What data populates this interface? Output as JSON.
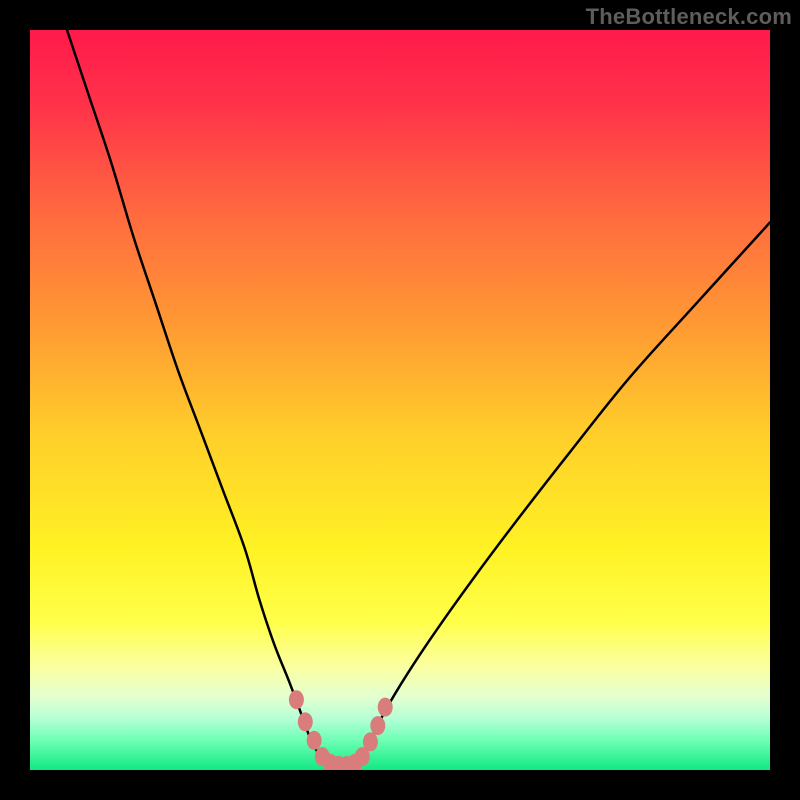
{
  "watermark": "TheBottleneck.com",
  "colors": {
    "frame": "#000000",
    "curve": "#000000",
    "marker_fill": "#d97c7c",
    "marker_stroke": "#a94b4b",
    "gradient_stops": [
      {
        "offset": 0.0,
        "color": "#ff1a4b"
      },
      {
        "offset": 0.1,
        "color": "#ff3249"
      },
      {
        "offset": 0.25,
        "color": "#ff6a3f"
      },
      {
        "offset": 0.4,
        "color": "#ff9a33"
      },
      {
        "offset": 0.55,
        "color": "#ffcf2a"
      },
      {
        "offset": 0.7,
        "color": "#fff224"
      },
      {
        "offset": 0.8,
        "color": "#ffff4a"
      },
      {
        "offset": 0.86,
        "color": "#fbffa0"
      },
      {
        "offset": 0.9,
        "color": "#e4ffcf"
      },
      {
        "offset": 0.93,
        "color": "#b6ffd7"
      },
      {
        "offset": 0.96,
        "color": "#6dffb4"
      },
      {
        "offset": 1.0,
        "color": "#12e884"
      }
    ]
  },
  "chart_data": {
    "type": "line",
    "title": "",
    "xlabel": "",
    "ylabel": "",
    "xlim": [
      0,
      100
    ],
    "ylim": [
      0,
      100
    ],
    "note": "V-shaped bottleneck-vs-utilization style curve. x in percent of range, y = bottleneck percent (0=bottom/green, 100=top/red). Values read from pixel positions.",
    "series": [
      {
        "name": "left-branch",
        "x": [
          5,
          8,
          11,
          14,
          17,
          20,
          23,
          26,
          29,
          31,
          33,
          35,
          36.5,
          38,
          39.5
        ],
        "y": [
          100,
          91,
          82,
          72,
          63,
          54,
          46,
          38,
          30,
          23,
          17,
          12,
          8,
          4,
          1.5
        ]
      },
      {
        "name": "right-branch",
        "x": [
          44.5,
          46,
          48,
          51,
          55,
          60,
          66,
          73,
          81,
          90,
          100
        ],
        "y": [
          1.5,
          4,
          8,
          13,
          19,
          26,
          34,
          43,
          53,
          63,
          74
        ]
      },
      {
        "name": "valley-floor",
        "x": [
          39.5,
          40.5,
          41.5,
          42.5,
          43.5,
          44.5
        ],
        "y": [
          1.5,
          0.8,
          0.5,
          0.5,
          0.8,
          1.5
        ]
      }
    ],
    "markers": {
      "name": "highlighted-points",
      "x": [
        36.0,
        37.2,
        38.4,
        39.5,
        40.6,
        41.7,
        42.8,
        43.9,
        44.9,
        46.0,
        47.0,
        48.0
      ],
      "y": [
        9.5,
        6.5,
        4.0,
        1.8,
        0.9,
        0.6,
        0.6,
        0.9,
        1.8,
        3.8,
        6.0,
        8.5
      ]
    }
  }
}
